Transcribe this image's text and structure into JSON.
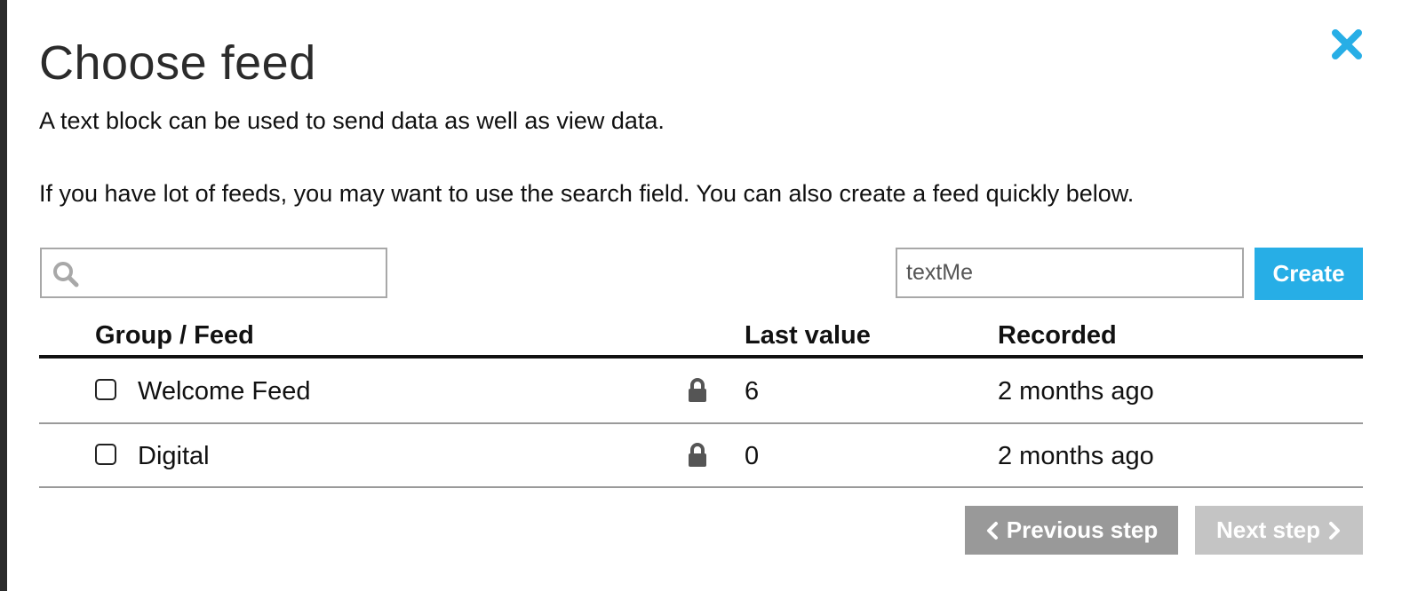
{
  "modal": {
    "title": "Choose feed",
    "description_1": "A text block can be used to send data as well as view data.",
    "description_2": "If you have lot of feeds, you may want to use the search field. You can also create a feed quickly below.",
    "close_icon": "close-x-icon"
  },
  "search": {
    "value": "",
    "placeholder": "",
    "icon": "search-icon"
  },
  "create": {
    "input_value": "textMe",
    "button_label": "Create"
  },
  "table": {
    "columns": [
      "Group / Feed",
      "Last value",
      "Recorded"
    ],
    "rows": [
      {
        "name": "Welcome Feed",
        "locked": true,
        "last_value": "6",
        "recorded": "2 months ago"
      },
      {
        "name": "Digital",
        "locked": true,
        "last_value": "0",
        "recorded": "2 months ago"
      }
    ]
  },
  "footer": {
    "previous_label": "Previous step",
    "next_label": "Next step"
  },
  "colors": {
    "accent": "#27aee6",
    "previous_button": "#999999",
    "next_button_disabled": "#c4c4c4"
  }
}
